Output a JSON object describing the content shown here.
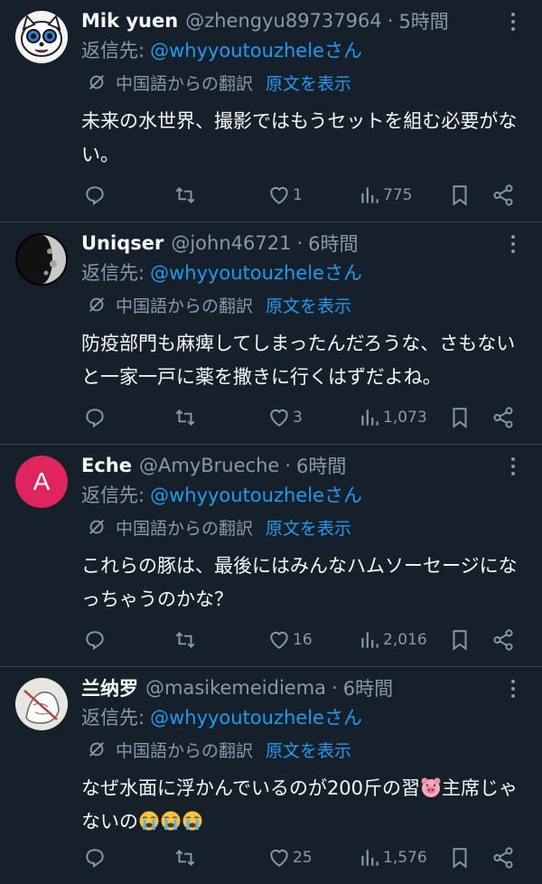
{
  "tweets": [
    {
      "name": "Mik yuen",
      "handle": "@zhengyu89737964",
      "time": "5時間",
      "reply_label": "返信先:",
      "reply_to": "@whyyoutouzheleさん",
      "translate_label": "中国語からの翻訳",
      "translate_link": "原文を表示",
      "text": "未来の水世界、撮影ではもうセットを組む必要がない。",
      "likes": "1",
      "views": "775",
      "avatar": "cartoon-white-cat"
    },
    {
      "name": "Uniqser",
      "handle": "@john46721",
      "time": "6時間",
      "reply_label": "返信先:",
      "reply_to": "@whyyoutouzheleさん",
      "translate_label": "中国語からの翻訳",
      "translate_link": "原文を表示",
      "text": "防疫部門も麻痺してしまったんだろうな、さもないと一家一戸に薬を撒きに行くはずだよね。",
      "likes": "3",
      "views": "1,073",
      "avatar": "half-moon"
    },
    {
      "name": "Eche",
      "handle": "@AmyBrueche",
      "time": "6時間",
      "reply_label": "返信先:",
      "reply_to": "@whyyoutouzheleさん",
      "translate_label": "中国語からの翻訳",
      "translate_link": "原文を表示",
      "text": "これらの豚は、最後にはみんなハムソーセージになっちゃうのかな？",
      "likes": "16",
      "views": "2,016",
      "avatar_letter": "A"
    },
    {
      "name": "兰纳罗",
      "handle": "@masikemeidiema",
      "time": "6時間",
      "reply_label": "返信先:",
      "reply_to": "@whyyoutouzheleさん",
      "translate_label": "中国語からの翻訳",
      "translate_link": "原文を表示",
      "text_a": "なぜ水面に浮かんでいるのが200斤の習",
      "text_b": "主席じゃないの",
      "likes": "25",
      "views": "1,576",
      "avatar": "sketch-drawing"
    }
  ],
  "colors": {
    "background": "#15202b",
    "link": "#1d9bf0",
    "muted": "#8b98a5",
    "divider": "#38444d",
    "avatar_letter_bg": "#e0245e"
  },
  "icons": [
    "reply-icon",
    "retweet-icon",
    "like-icon",
    "views-icon",
    "bookmark-icon",
    "share-icon",
    "translate-icon",
    "more-icon",
    "pig-face-emoji",
    "crying-face-emoji"
  ]
}
